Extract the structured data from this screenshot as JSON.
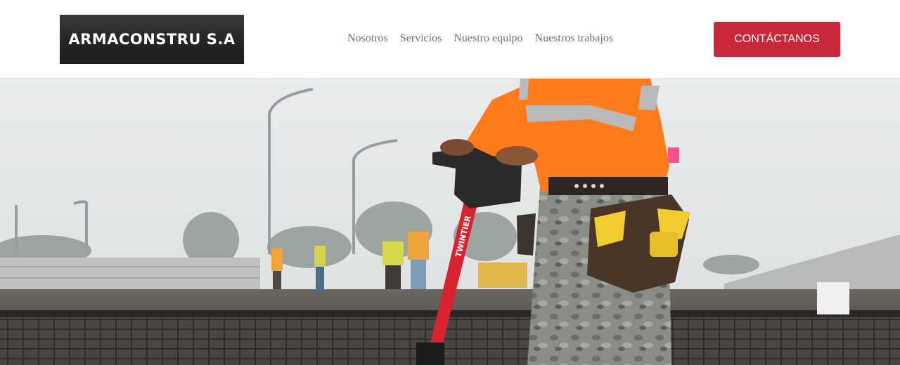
{
  "brand": {
    "logo_text": "ARMACONSTRU S.A"
  },
  "nav": {
    "items": [
      {
        "label": "Nosotros"
      },
      {
        "label": "Servicios"
      },
      {
        "label": "Nuestro equipo"
      },
      {
        "label": "Nuestros trabajos"
      }
    ]
  },
  "cta": {
    "label": "CONTÁCTANOS"
  },
  "hero": {
    "image_alt": "",
    "device_brand": "TWINTIER",
    "colors": {
      "vest": "#ff7a1a",
      "accent": "#c8283a",
      "reflective": "#b9b9b9"
    }
  },
  "colors": {
    "accent": "#c8283a",
    "nav_text": "#6f6f6f"
  }
}
